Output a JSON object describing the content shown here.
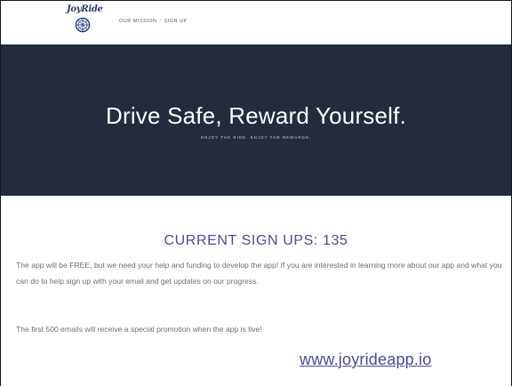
{
  "header": {
    "logo_text": "JoyRide",
    "nav": [
      {
        "label": "OUR MISSION"
      },
      {
        "label": "SIGN UP"
      }
    ],
    "nav_separator": "/"
  },
  "hero": {
    "title": "Drive Safe, Reward Yourself.",
    "subtitle": "ENJOY THE RIDE. ENJOY THE REWARDS.",
    "background_color": "#232b3d"
  },
  "main": {
    "signup_count": "CURRENT SIGN UPS: 135",
    "paragraph_1": "The app will be FREE, but we need your help and funding to develop the app! If you are interested in learning more about our app and what you can do to help sign up with your email and get updates on our progress.",
    "paragraph_2": "The first 500 emails will receive a special promotion when the app is live!",
    "website_link": "www.joyrideapp.io",
    "accent_color": "#4b4a9a"
  },
  "icons": {
    "logo": "wheel-icon"
  }
}
